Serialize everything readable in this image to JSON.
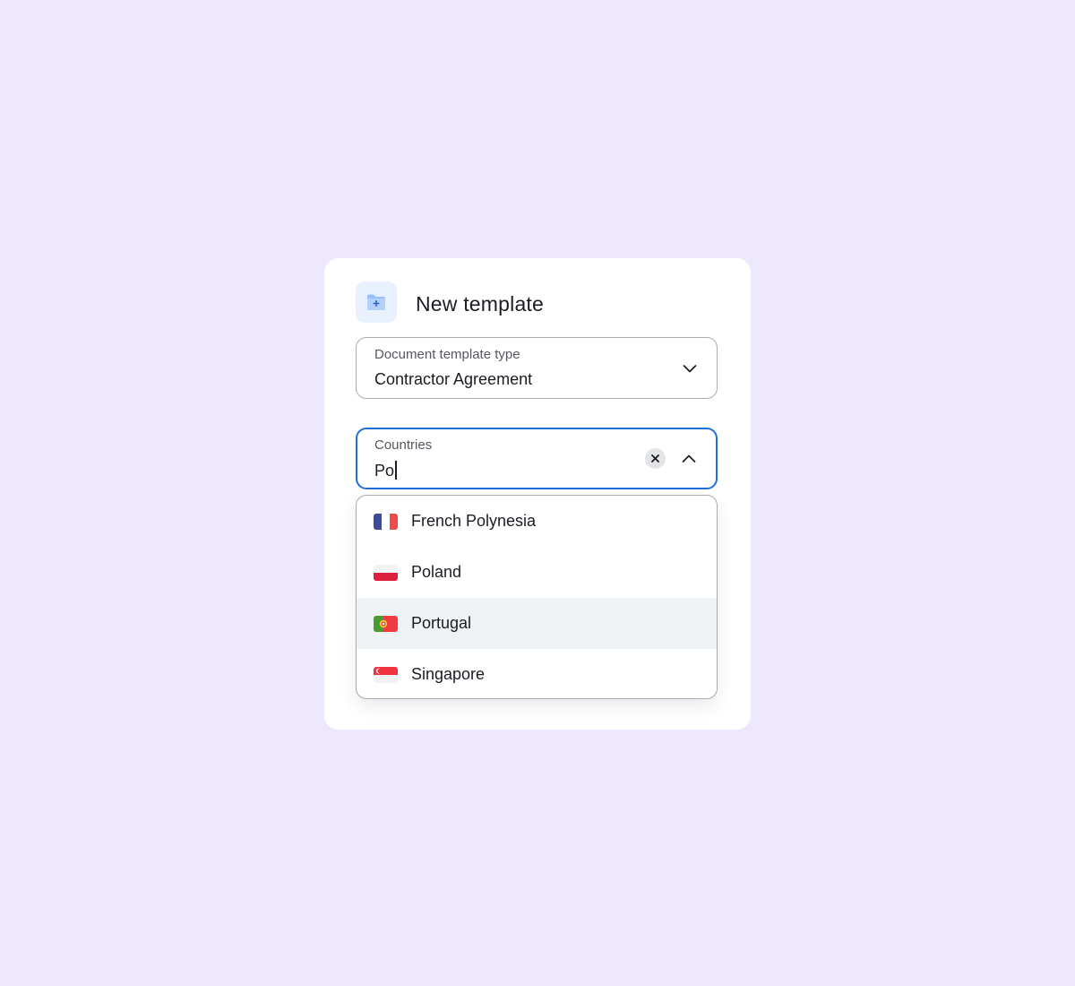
{
  "dialog": {
    "title": "New template",
    "icon": "folder-add-icon"
  },
  "template_type": {
    "label": "Document template type",
    "value": "Contractor Agreement",
    "icon": "chevron-down-icon"
  },
  "countries": {
    "label": "Countries",
    "value": "Po",
    "clear_icon": "close-icon",
    "toggle_icon": "chevron-up-icon",
    "focus_color": "#1f6fd9",
    "options": [
      {
        "label": "French Polynesia",
        "flag": "france-flag-icon"
      },
      {
        "label": "Poland",
        "flag": "poland-flag-icon"
      },
      {
        "label": "Portugal",
        "flag": "portugal-flag-icon",
        "highlighted": true
      },
      {
        "label": "Singapore",
        "flag": "singapore-flag-icon"
      }
    ]
  },
  "colors": {
    "background": "#ede8fe",
    "accent": "#1f6fd9",
    "highlight_row": "#eff2f5"
  }
}
